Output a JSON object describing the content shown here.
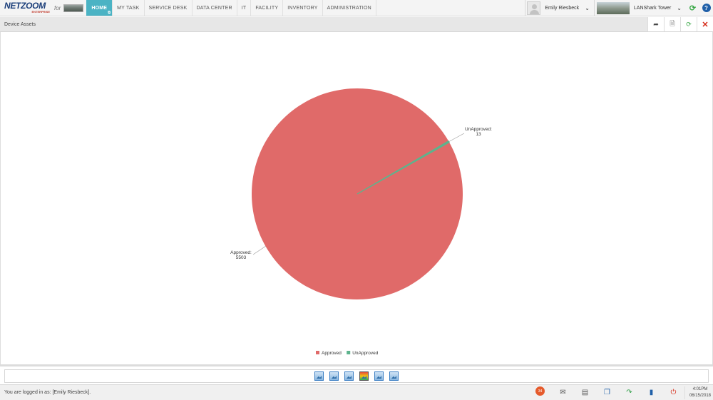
{
  "app": {
    "logo_text": "NETZOOM",
    "logo_sub": "ENTERPRISE",
    "for_text": "for"
  },
  "nav": {
    "items": [
      "HOME",
      "MY TASK",
      "SERVICE DESK",
      "DATA CENTER",
      "IT",
      "FACILITY",
      "INVENTORY",
      "ADMINISTRATION"
    ],
    "active": "HOME"
  },
  "user": {
    "name": "Emily Riesbeck",
    "site": "LANShark Tower"
  },
  "panel": {
    "title": "Device Assets",
    "tools": [
      "share-icon",
      "pdf-icon",
      "refresh-icon",
      "close-icon"
    ]
  },
  "chart_data": {
    "type": "pie",
    "categories": [
      "Approved",
      "UnApproved"
    ],
    "values": [
      5503,
      13
    ],
    "colors": [
      "#e06a69",
      "#5db38d"
    ],
    "data_labels": [
      {
        "name": "Approved",
        "value": "5503"
      },
      {
        "name": "UnApproved",
        "value": "13"
      }
    ],
    "legend": {
      "position": "bottom-center",
      "entries": [
        "Approved",
        "UnApproved"
      ]
    }
  },
  "thumbnails": [
    "chart-thumb-icon",
    "chart-thumb-icon",
    "chart-thumb-icon",
    "chart-thumb-special-icon",
    "chart-thumb-icon",
    "chart-thumb-icon"
  ],
  "status": {
    "logged_in_text": "You are logged in as: [Emily Riesbeck].",
    "notification_count": "34",
    "time": "4:01PM",
    "date": "06/15/2018"
  }
}
